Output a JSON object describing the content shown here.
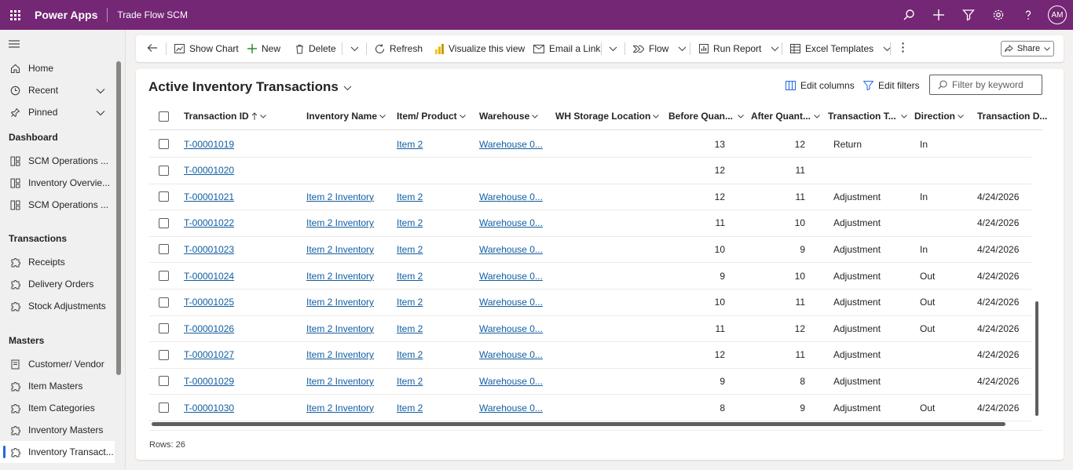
{
  "topbar": {
    "app_name": "Power Apps",
    "env_name": "Trade Flow SCM",
    "avatar_initials": "AM",
    "icons": [
      "search-icon",
      "add-icon",
      "filter-icon",
      "settings-icon",
      "help-icon"
    ],
    "color": "#742774"
  },
  "sidebar": {
    "top_items": [
      {
        "label": "Home",
        "icon": "home-icon"
      },
      {
        "label": "Recent",
        "icon": "clock-icon",
        "chevron": true
      },
      {
        "label": "Pinned",
        "icon": "pin-icon",
        "chevron": true
      }
    ],
    "groups": [
      {
        "title": "Dashboard",
        "items": [
          "SCM Operations ...",
          "Inventory Overvie...",
          "SCM Operations ..."
        ]
      },
      {
        "title": "Transactions",
        "items": [
          "Receipts",
          "Delivery Orders",
          "Stock Adjustments"
        ]
      },
      {
        "title": "Masters",
        "items": [
          "Customer/ Vendor",
          "Item Masters",
          "Item Categories",
          "Inventory Masters",
          "Inventory Transact..."
        ]
      }
    ]
  },
  "commandbar": {
    "show_chart": "Show Chart",
    "new": "New",
    "delete": "Delete",
    "refresh": "Refresh",
    "visualize": "Visualize this view",
    "email_link": "Email a Link",
    "flow": "Flow",
    "run_report": "Run Report",
    "excel_templates": "Excel Templates",
    "share": "Share"
  },
  "view": {
    "title": "Active Inventory Transactions",
    "edit_columns": "Edit columns",
    "edit_filters": "Edit filters",
    "filter_placeholder": "Filter by keyword",
    "rows_count": "Rows: 26"
  },
  "grid": {
    "columns": [
      "Transaction ID",
      "Inventory Name",
      "Item/ Product",
      "Warehouse",
      "WH Storage Location",
      "Before Quan...",
      "After Quant...",
      "Transaction T...",
      "Direction",
      "Transaction D..."
    ],
    "rows": [
      {
        "id": "T-00001019",
        "inv": "",
        "item": "Item 2",
        "wh": "Warehouse 0...",
        "loc": "",
        "before": "13",
        "after": "12",
        "type": "Return",
        "dir": "In",
        "date": ""
      },
      {
        "id": "T-00001020",
        "inv": "",
        "item": "",
        "wh": "",
        "loc": "",
        "before": "12",
        "after": "11",
        "type": "",
        "dir": "",
        "date": ""
      },
      {
        "id": "T-00001021",
        "inv": "Item 2 Inventory",
        "item": "Item 2",
        "wh": "Warehouse 0...",
        "loc": "",
        "before": "12",
        "after": "11",
        "type": "Adjustment",
        "dir": "In",
        "date": "4/24/2026"
      },
      {
        "id": "T-00001022",
        "inv": "Item 2 Inventory",
        "item": "Item 2",
        "wh": "Warehouse 0...",
        "loc": "",
        "before": "11",
        "after": "10",
        "type": "Adjustment",
        "dir": "",
        "date": "4/24/2026"
      },
      {
        "id": "T-00001023",
        "inv": "Item 2 Inventory",
        "item": "Item 2",
        "wh": "Warehouse 0...",
        "loc": "",
        "before": "10",
        "after": "9",
        "type": "Adjustment",
        "dir": "In",
        "date": "4/24/2026"
      },
      {
        "id": "T-00001024",
        "inv": "Item 2 Inventory",
        "item": "Item 2",
        "wh": "Warehouse 0...",
        "loc": "",
        "before": "9",
        "after": "10",
        "type": "Adjustment",
        "dir": "Out",
        "date": "4/24/2026"
      },
      {
        "id": "T-00001025",
        "inv": "Item 2 Inventory",
        "item": "Item 2",
        "wh": "Warehouse 0...",
        "loc": "",
        "before": "10",
        "after": "11",
        "type": "Adjustment",
        "dir": "Out",
        "date": "4/24/2026"
      },
      {
        "id": "T-00001026",
        "inv": "Item 2 Inventory",
        "item": "Item 2",
        "wh": "Warehouse 0...",
        "loc": "",
        "before": "11",
        "after": "12",
        "type": "Adjustment",
        "dir": "Out",
        "date": "4/24/2026"
      },
      {
        "id": "T-00001027",
        "inv": "Item 2 Inventory",
        "item": "Item 2",
        "wh": "Warehouse 0...",
        "loc": "",
        "before": "12",
        "after": "11",
        "type": "Adjustment",
        "dir": "",
        "date": "4/24/2026"
      },
      {
        "id": "T-00001029",
        "inv": "Item 2 Inventory",
        "item": "Item 2",
        "wh": "Warehouse 0...",
        "loc": "",
        "before": "9",
        "after": "8",
        "type": "Adjustment",
        "dir": "",
        "date": "4/24/2026"
      },
      {
        "id": "T-00001030",
        "inv": "Item 2 Inventory",
        "item": "Item 2",
        "wh": "Warehouse 0...",
        "loc": "",
        "before": "8",
        "after": "9",
        "type": "Adjustment",
        "dir": "Out",
        "date": "4/24/2026"
      }
    ]
  }
}
